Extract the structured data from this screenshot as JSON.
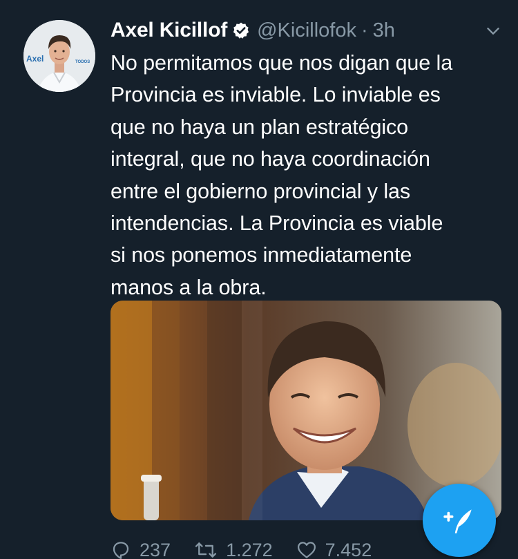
{
  "tweet": {
    "display_name": "Axel Kicillof",
    "handle": "@Kicillofok",
    "separator": "·",
    "time": "3h",
    "verified": true,
    "text_lines": [
      "No permitamos que nos digan que la",
      "Provincia es inviable. Lo inviable es",
      "que no haya un plan estratégico",
      "integral, que no haya coordinación",
      "entre el gobierno provincial y las",
      "intendencias. La Provincia es viable",
      "si nos ponemos inmediatamente",
      "manos a la obra."
    ],
    "avatar": {
      "label": "Axel",
      "badge": "TODOS"
    },
    "media_alt_icon": "photo"
  },
  "actions": {
    "replies": "237",
    "retweets": "1.272",
    "likes": "7.452"
  },
  "colors": {
    "background": "#15202b",
    "text": "#ffffff",
    "secondary": "#8899a6",
    "accent": "#1da1f2"
  },
  "icons": {
    "verified": "verified-badge-icon",
    "chevron": "chevron-down-icon",
    "reply": "reply-icon",
    "retweet": "retweet-icon",
    "like": "heart-icon",
    "compose": "compose-tweet-icon"
  }
}
